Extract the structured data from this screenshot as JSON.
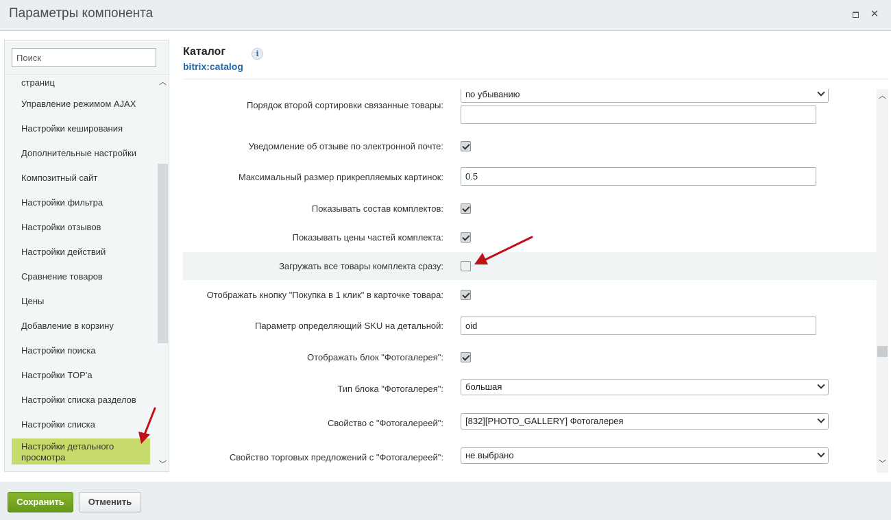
{
  "window": {
    "title": "Параметры компонента"
  },
  "sidebar": {
    "search_placeholder": "Поиск",
    "items": [
      {
        "label": "страниц"
      },
      {
        "label": "Управление режимом AJAX"
      },
      {
        "label": "Настройки кеширования"
      },
      {
        "label": "Дополнительные настройки"
      },
      {
        "label": "Композитный сайт"
      },
      {
        "label": "Настройки фильтра"
      },
      {
        "label": "Настройки отзывов"
      },
      {
        "label": "Настройки действий"
      },
      {
        "label": "Сравнение товаров"
      },
      {
        "label": "Цены"
      },
      {
        "label": "Добавление в корзину"
      },
      {
        "label": "Настройки поиска"
      },
      {
        "label": "Настройки TOP'а"
      },
      {
        "label": "Настройки списка разделов"
      },
      {
        "label": "Настройки списка"
      },
      {
        "label": "Настройки детального просмотра",
        "active": true
      }
    ]
  },
  "main": {
    "title": "Каталог",
    "subtitle": "bitrix:catalog",
    "info_icon": "i",
    "rows": [
      {
        "label": "Порядок второй сортировки связанные товары:",
        "type": "select",
        "value": "по убыванию"
      },
      {
        "label": "Уведомление об отзыве по электронной почте:",
        "type": "checkbox",
        "checked": true
      },
      {
        "label": "Максимальный размер прикрепляемых картинок:",
        "type": "input",
        "value": "0.5"
      },
      {
        "label": "Показывать состав комплектов:",
        "type": "checkbox",
        "checked": true
      },
      {
        "label": "Показывать цены частей комплекта:",
        "type": "checkbox",
        "checked": true
      },
      {
        "label": "Загружать все товары комплекта сразу:",
        "type": "checkbox",
        "checked": false
      },
      {
        "label": "Отображать кнопку \"Покупка в 1 клик\" в карточке товара:",
        "type": "checkbox",
        "checked": true
      },
      {
        "label": "Параметр определяющий SKU на детальной:",
        "type": "input",
        "value": "oid"
      },
      {
        "label": "Отображать блок \"Фотогалерея\":",
        "type": "checkbox",
        "checked": true
      },
      {
        "label": "Тип блока \"Фотогалерея\":",
        "type": "select",
        "value": "большая"
      },
      {
        "label": "Свойство с \"Фотогалереей\":",
        "type": "select",
        "value": "[832][PHOTO_GALLERY] Фотогалерея"
      },
      {
        "label": "Свойство торговых предложений с \"Фотогалереей\":",
        "type": "select",
        "value": "не выбрано"
      }
    ]
  },
  "footer": {
    "save_label": "Сохранить",
    "cancel_label": "Отменить"
  },
  "colors": {
    "save_button": "#6fa421",
    "active_item": "#c6db6c",
    "annotation_arrow": "#c0101a",
    "subtitle": "#2067b0"
  }
}
